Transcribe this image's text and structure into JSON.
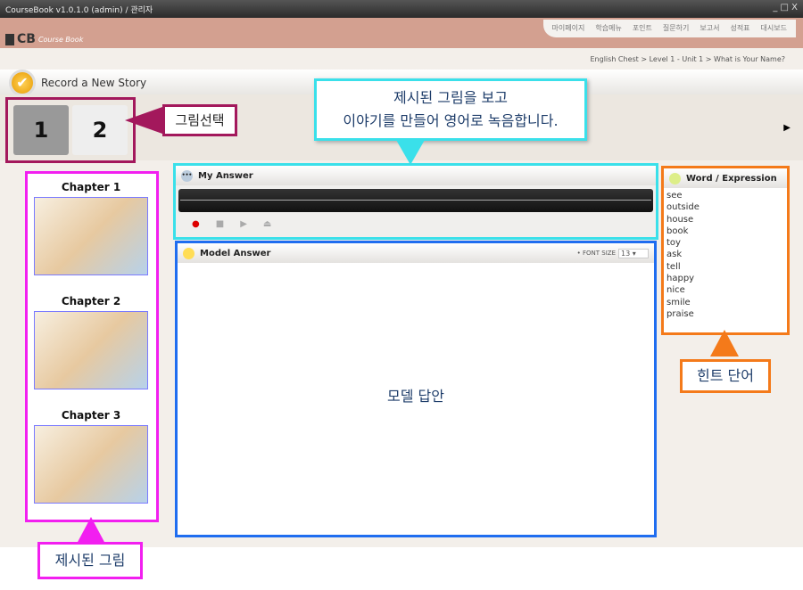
{
  "window": {
    "title": "CourseBook v1.0.1.0 (admin) / 관리자",
    "controls": "_ □ X"
  },
  "header": {
    "logo": "CB",
    "logo_sub": "Course Book",
    "menu": [
      "마이페이지",
      "학습메뉴",
      "포인트",
      "질문하기",
      "보고서",
      "성적표",
      "대시보드"
    ]
  },
  "breadcrumb": "English Chest > Level 1 - Unit 1 > What is Your Name?",
  "story": {
    "title": "Record a New Story",
    "picture_buttons": [
      "1",
      "2"
    ],
    "next_icon": "▶"
  },
  "chapters": [
    {
      "label": "Chapter 1"
    },
    {
      "label": "Chapter 2"
    },
    {
      "label": "Chapter 3"
    }
  ],
  "my_answer": {
    "title": "My Answer",
    "controls": [
      "record-icon",
      "stop-icon",
      "play-icon",
      "eject-icon"
    ]
  },
  "model_answer": {
    "title": "Model Answer",
    "font_size_label": "• FONT SIZE",
    "font_size": "13",
    "placeholder": "모델 답안"
  },
  "words": {
    "title": "Word / Expression",
    "items": [
      "see",
      "outside",
      "house",
      "book",
      "toy",
      "ask",
      "tell",
      "happy",
      "nice",
      "smile",
      "praise"
    ]
  },
  "callouts": {
    "select": "그림선택",
    "instruction_1": "제시된 그림을 보고",
    "instruction_2": "이야기를 만들어 영어로 녹음합니다.",
    "hint": "힌트 단어",
    "pictures": "제시된 그림"
  },
  "colors": {
    "header": "#d3a090",
    "callout_magenta": "#f21ff0",
    "callout_cyan": "#3ae0ea",
    "callout_orange": "#f47a1a",
    "callout_blue": "#1f6df0"
  }
}
